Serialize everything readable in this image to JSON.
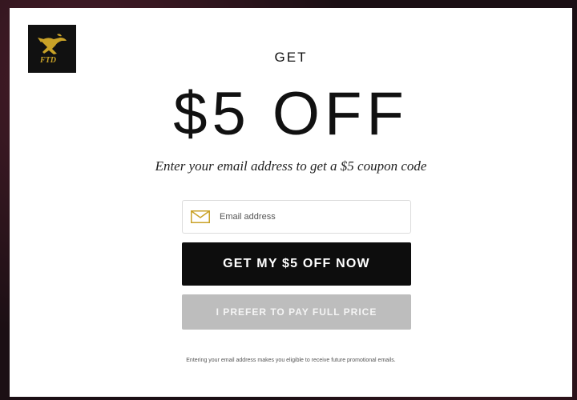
{
  "popup": {
    "eyebrow": "GET",
    "headline": "$5 OFF",
    "subheadline": "Enter your email address to get a $5 coupon code",
    "email_placeholder": "Email address",
    "email_icon": "envelope-icon",
    "primary_button_label": "GET MY $5 OFF NOW",
    "secondary_button_label": "I PREFER TO PAY FULL PRICE",
    "disclaimer": "Entering your email address makes you eligible to receive future promotional emails."
  },
  "logo": {
    "text": "FTD",
    "icon": "mercury-logo-icon"
  },
  "colors": {
    "brand_gold": "#c9a227",
    "primary_button_bg": "#0d0d0d",
    "secondary_button_bg": "#bdbdbd",
    "modal_bg": "#ffffff"
  }
}
